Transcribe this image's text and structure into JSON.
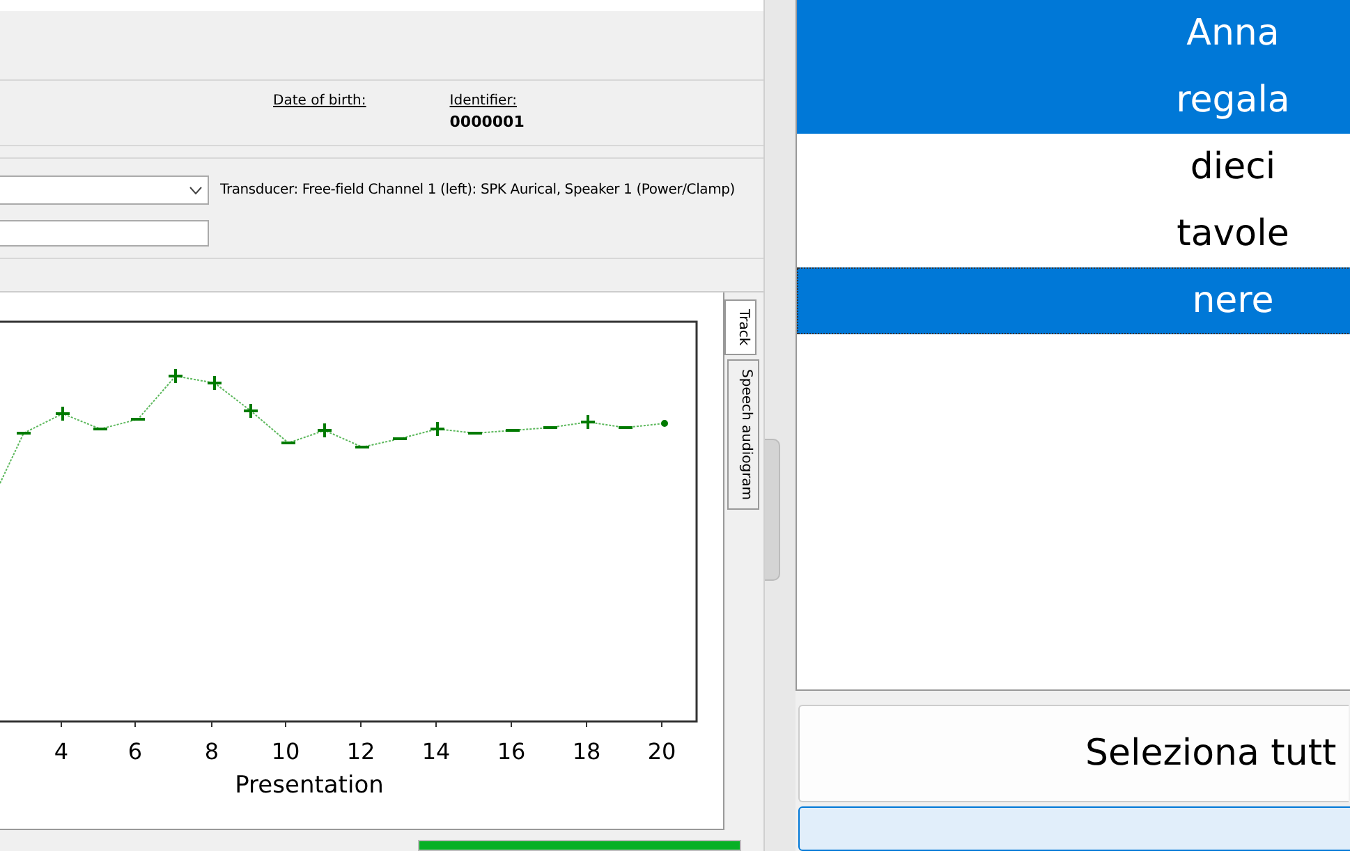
{
  "patient": {
    "fields": [
      {
        "label": "Date of birth:"
      },
      {
        "label": "Identifier:",
        "value": "0000001"
      }
    ]
  },
  "settings": {
    "transducer": "Transducer: Free-field  Channel 1 (left): SPK Aurical, Speaker 1 (Power/Clamp)"
  },
  "chart": {
    "xticks": [
      "4",
      "6",
      "8",
      "10",
      "12",
      "14",
      "16",
      "18",
      "20"
    ],
    "xlabel": "Presentation"
  },
  "side_tabs": [
    {
      "label": "Track",
      "selected": true
    },
    {
      "label": "Speech audiogram",
      "selected": false
    }
  ],
  "progress": {
    "level": 1
  },
  "words": [
    {
      "text": "Anna",
      "selected": true
    },
    {
      "text": "regala",
      "selected": true
    },
    {
      "text": "dieci",
      "selected": false
    },
    {
      "text": "tavole",
      "selected": false
    },
    {
      "text": "nere",
      "selected": true
    }
  ],
  "buttons": [
    "Seleziona tutt"
  ]
}
